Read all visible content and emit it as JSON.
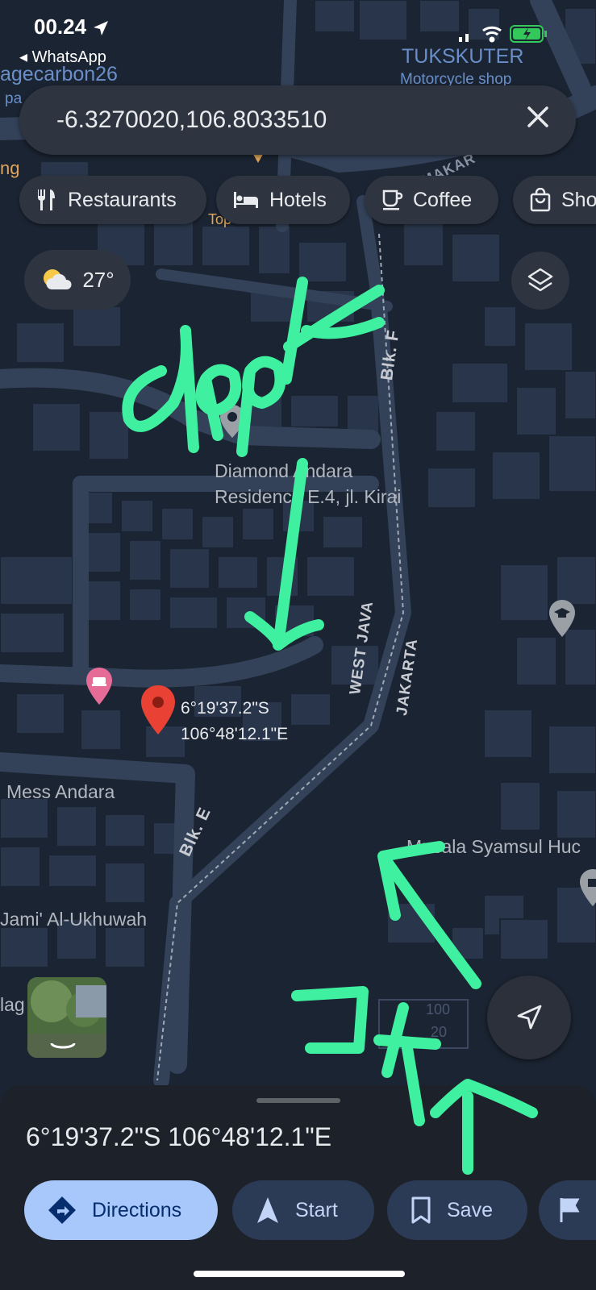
{
  "status_bar": {
    "time": "00.24",
    "back_app": "◂ WhatsApp"
  },
  "search": {
    "value": "-6.3270020,106.8033510"
  },
  "chips": [
    {
      "label": "Restaurants",
      "icon": "fork-knife-icon"
    },
    {
      "label": "Hotels",
      "icon": "bed-icon"
    },
    {
      "label": "Coffee",
      "icon": "coffee-cup-icon"
    },
    {
      "label": "Sho",
      "icon": "shopping-bag-icon"
    }
  ],
  "weather": {
    "temp": "27°",
    "icon": "partly-cloudy-icon"
  },
  "map_labels": {
    "tukskuter": "TUKSKUTER",
    "tukskuter_sub": "Motorcycle shop",
    "agecarbon": "agecarbon26",
    "pa": "pa",
    "ng": "ng",
    "top": "Top",
    "diamond_line1": "Diamond Andara",
    "diamond_line2": "Residence E.4, jl. Kirai",
    "mess_andara": "Mess Andara",
    "jami": "Jami' Al-Ukhuwah",
    "musala": "Musala Syamsul Huc",
    "lag": "lag",
    "blk_f": "Blk. F",
    "blk_e": "Blk. E",
    "west_java": "WEST JAVA",
    "jakarta": "JAKARTA",
    "makar": "MAKAR",
    "scale_top": "100",
    "scale_bottom": "20"
  },
  "pin": {
    "lat": "6°19'37.2\"S",
    "lng": "106°48'12.1\"E"
  },
  "sheet": {
    "title": "6°19'37.2\"S 106°48'12.1\"E"
  },
  "actions": [
    {
      "label": "Directions",
      "icon": "directions-icon"
    },
    {
      "label": "Start",
      "icon": "navigation-arrow-icon"
    },
    {
      "label": "Save",
      "icon": "bookmark-icon"
    }
  ],
  "colors": {
    "pin_red": "#e94235",
    "accent_blue": "#a8c7fa",
    "annotation_green": "#3ff0a0"
  }
}
